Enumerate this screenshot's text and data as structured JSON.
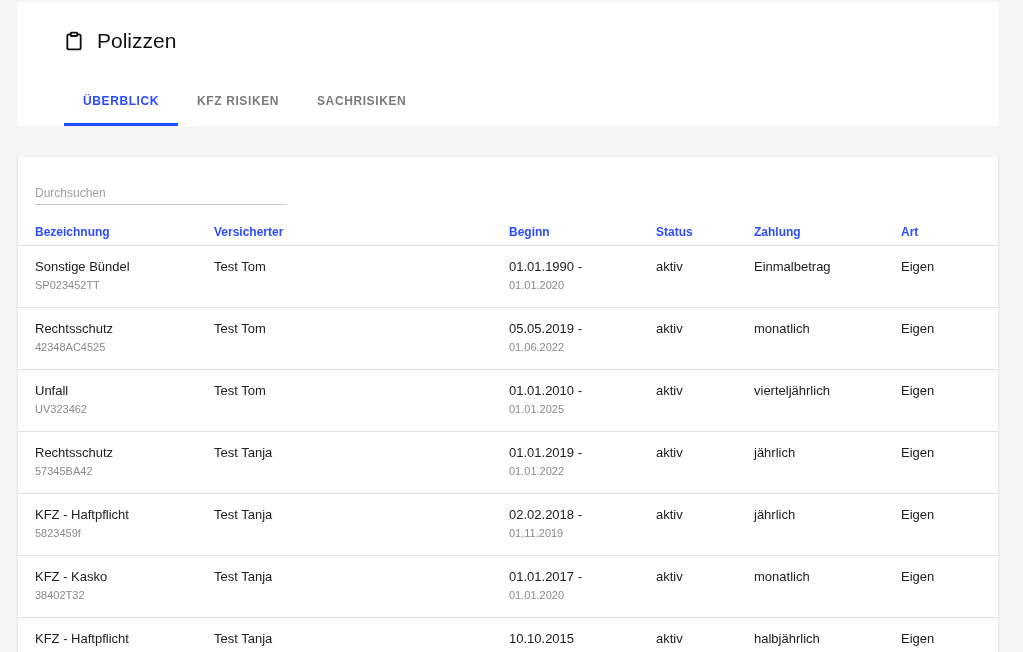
{
  "page": {
    "title": "Polizzen"
  },
  "tabs": [
    {
      "label": "ÜBERBLICK",
      "selected": true
    },
    {
      "label": "KFZ RISIKEN",
      "selected": false
    },
    {
      "label": "SACHRISIKEN",
      "selected": false
    }
  ],
  "search": {
    "placeholder": "Durchsuchen"
  },
  "table": {
    "columns": [
      "Bezeichnung",
      "Versicherter",
      "Beginn",
      "Status",
      "Zahlung",
      "Art"
    ],
    "rows": [
      {
        "name": "Sonstige Bündel",
        "number": "SP023452TT",
        "insured": "Test Tom",
        "start": "01.01.1990 -",
        "end": "01.01.2020",
        "status": "aktiv",
        "payment": "Einmalbetrag",
        "type": "Eigen"
      },
      {
        "name": "Rechtsschutz",
        "number": "42348AC4525",
        "insured": "Test Tom",
        "start": "05.05.2019 -",
        "end": "01.06.2022",
        "status": "aktiv",
        "payment": "monatlich",
        "type": "Eigen"
      },
      {
        "name": "Unfall",
        "number": "UV323462",
        "insured": "Test Tom",
        "start": "01.01.2010 -",
        "end": "01.01.2025",
        "status": "aktiv",
        "payment": "vierteljährlich",
        "type": "Eigen"
      },
      {
        "name": "Rechtsschutz",
        "number": "57345BA42",
        "insured": "Test Tanja",
        "start": "01.01.2019 -",
        "end": "01.01.2022",
        "status": "aktiv",
        "payment": "jährlich",
        "type": "Eigen"
      },
      {
        "name": "KFZ - Haftpflicht",
        "number": "5823459f",
        "insured": "Test Tanja",
        "start": "02.02.2018 -",
        "end": "01.11.2019",
        "status": "aktiv",
        "payment": "jährlich",
        "type": "Eigen"
      },
      {
        "name": "KFZ - Kasko",
        "number": "38402T32",
        "insured": "Test Tanja",
        "start": "01.01.2017 -",
        "end": "01.01.2020",
        "status": "aktiv",
        "payment": "monatlich",
        "type": "Eigen"
      },
      {
        "name": "KFZ - Haftpflicht",
        "insured": "Test Tanja",
        "start": "10.10.2015",
        "status": "aktiv",
        "payment": "halbjährlich",
        "type": "Eigen"
      }
    ]
  }
}
